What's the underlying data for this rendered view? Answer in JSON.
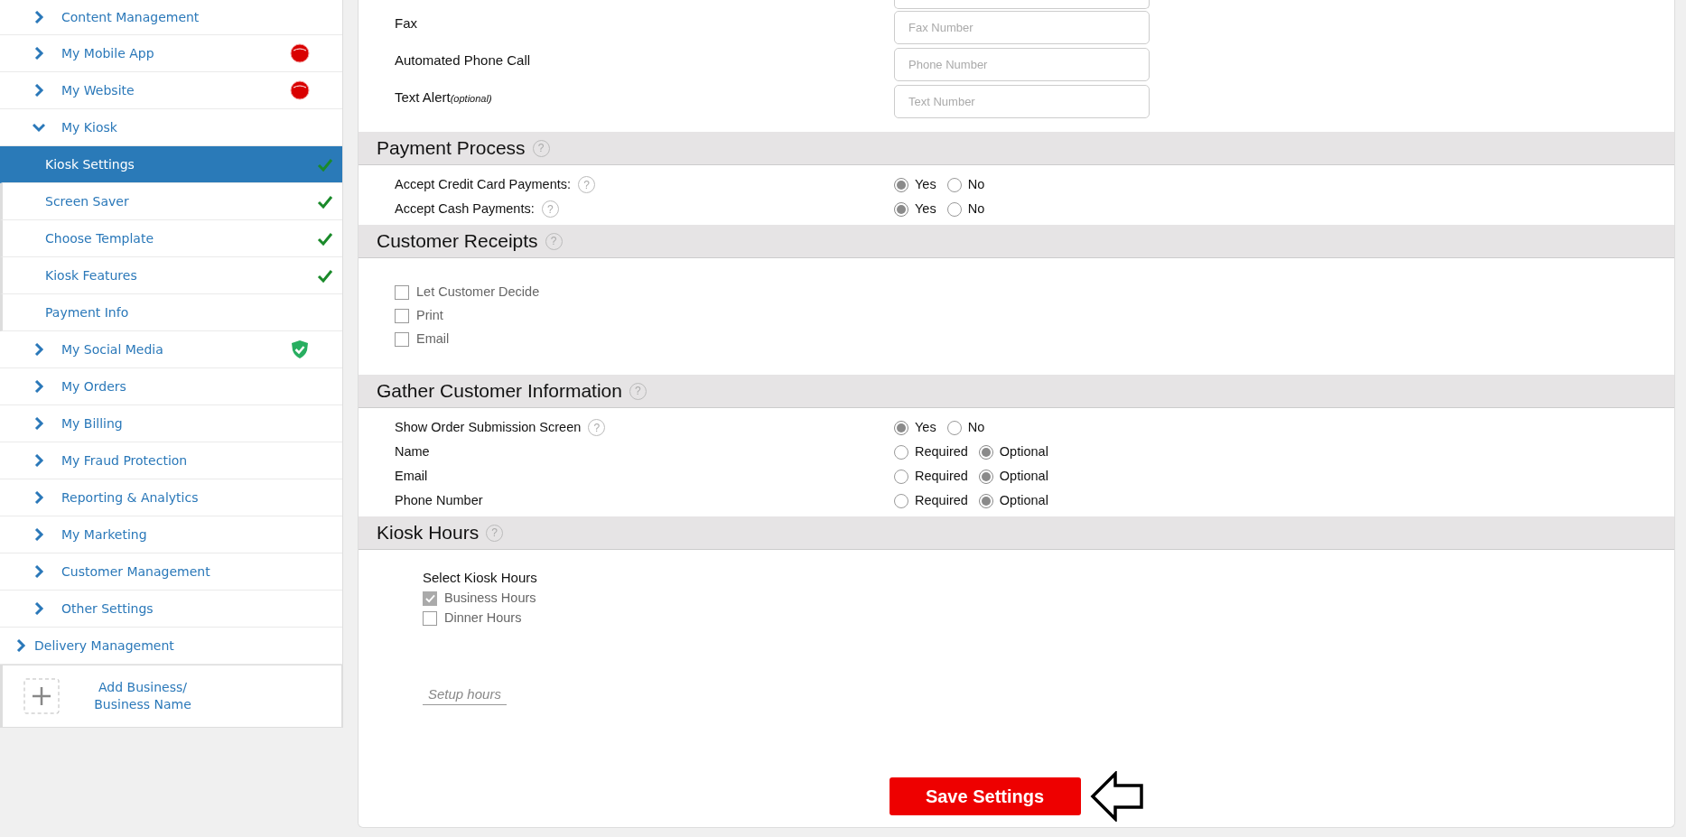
{
  "sidebar": {
    "items": [
      {
        "label": "Content Management",
        "kind": "group",
        "expanded": false
      },
      {
        "label": "My Mobile App",
        "kind": "group",
        "expanded": false,
        "alert": true
      },
      {
        "label": "My Website",
        "kind": "group",
        "expanded": false,
        "alert": true
      },
      {
        "label": "My Kiosk",
        "kind": "group",
        "expanded": true,
        "children": [
          {
            "label": "Kiosk Settings",
            "selected": true,
            "done": true
          },
          {
            "label": "Screen Saver",
            "selected": false,
            "done": true
          },
          {
            "label": "Choose Template",
            "selected": false,
            "done": true
          },
          {
            "label": "Kiosk Features",
            "selected": false,
            "done": true
          },
          {
            "label": "Payment Info",
            "selected": false,
            "done": false
          }
        ]
      },
      {
        "label": "My Social Media",
        "kind": "group",
        "expanded": false,
        "verified": true
      },
      {
        "label": "My Orders",
        "kind": "group",
        "expanded": false
      },
      {
        "label": "My Billing",
        "kind": "group",
        "expanded": false
      },
      {
        "label": "My Fraud Protection",
        "kind": "group",
        "expanded": false
      },
      {
        "label": "Reporting & Analytics",
        "kind": "group",
        "expanded": false
      },
      {
        "label": "My Marketing",
        "kind": "group",
        "expanded": false
      },
      {
        "label": "Customer Management",
        "kind": "group",
        "expanded": false
      },
      {
        "label": "Other Settings",
        "kind": "group",
        "expanded": false
      },
      {
        "label": "Delivery Management",
        "kind": "section",
        "expanded": false
      }
    ],
    "add_business": {
      "label": "Add Business/ Business Name"
    }
  },
  "contact": [
    {
      "kind": "clipped"
    },
    {
      "kind": "field",
      "label": "Fax",
      "placeholder": "Fax Number"
    },
    {
      "kind": "field",
      "label": "Automated Phone Call",
      "placeholder": "Phone Number"
    },
    {
      "kind": "field",
      "label": "Text Alert",
      "hint": "(optional)",
      "placeholder": "Text Number"
    }
  ],
  "sections": [
    {
      "title": "Payment Process",
      "help": "?",
      "kind": "radios",
      "rows": [
        {
          "label": "Accept Credit Card Payments:",
          "help": "?",
          "options": [
            {
              "label": "Yes",
              "selected": true
            },
            {
              "label": "No",
              "selected": false
            }
          ]
        },
        {
          "label": "Accept Cash Payments:",
          "help": "?",
          "options": [
            {
              "label": "Yes",
              "selected": true
            },
            {
              "label": "No",
              "selected": false
            }
          ]
        }
      ]
    },
    {
      "title": "Customer Receipts",
      "help": "?",
      "kind": "checks",
      "items": [
        {
          "label": "Let Customer Decide",
          "checked": false
        },
        {
          "label": "Print",
          "checked": false
        },
        {
          "label": "Email",
          "checked": false
        }
      ]
    },
    {
      "title": "Gather Customer Information",
      "help": "?",
      "kind": "radios",
      "rows": [
        {
          "label": "Show Order Submission Screen",
          "help": "?",
          "options": [
            {
              "label": "Yes",
              "selected": true
            },
            {
              "label": "No",
              "selected": false
            }
          ]
        },
        {
          "label": "Name",
          "options": [
            {
              "label": "Required",
              "selected": false
            },
            {
              "label": "Optional",
              "selected": true
            }
          ]
        },
        {
          "label": "Email",
          "options": [
            {
              "label": "Required",
              "selected": false
            },
            {
              "label": "Optional",
              "selected": true
            }
          ]
        },
        {
          "label": "Phone Number",
          "options": [
            {
              "label": "Required",
              "selected": false
            },
            {
              "label": "Optional",
              "selected": true
            }
          ]
        }
      ]
    },
    {
      "title": "Kiosk Hours",
      "help": "?",
      "kind": "hours",
      "subtitle": "Select Kiosk Hours",
      "items": [
        {
          "label": "Business Hours",
          "checked": true
        },
        {
          "label": "Dinner Hours",
          "checked": false
        }
      ],
      "link": "Setup hours"
    }
  ],
  "save_button": "Save Settings"
}
